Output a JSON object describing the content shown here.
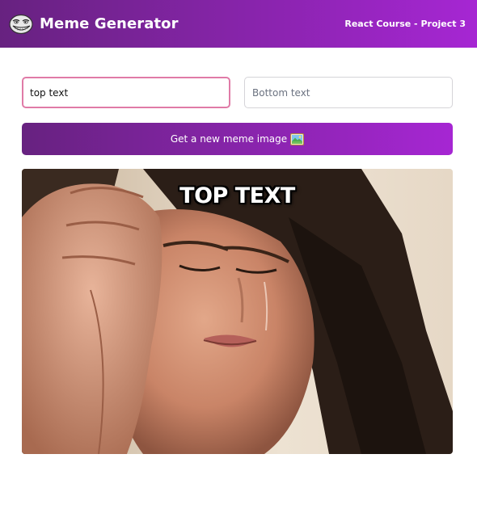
{
  "header": {
    "title": "Meme Generator",
    "subtitle": "React Course - Project 3",
    "logo_icon": "troll-face-icon",
    "gradient_start": "#672280",
    "gradient_end": "#A626D3"
  },
  "form": {
    "top_text_value": "top text",
    "top_text_placeholder": "Top text",
    "bottom_text_value": "",
    "bottom_text_placeholder": "Bottom text",
    "button_label": "Get a new meme image",
    "button_icon": "picture-icon"
  },
  "meme": {
    "image": "crying-woman-photo",
    "top_text": "top text",
    "bottom_text": ""
  }
}
